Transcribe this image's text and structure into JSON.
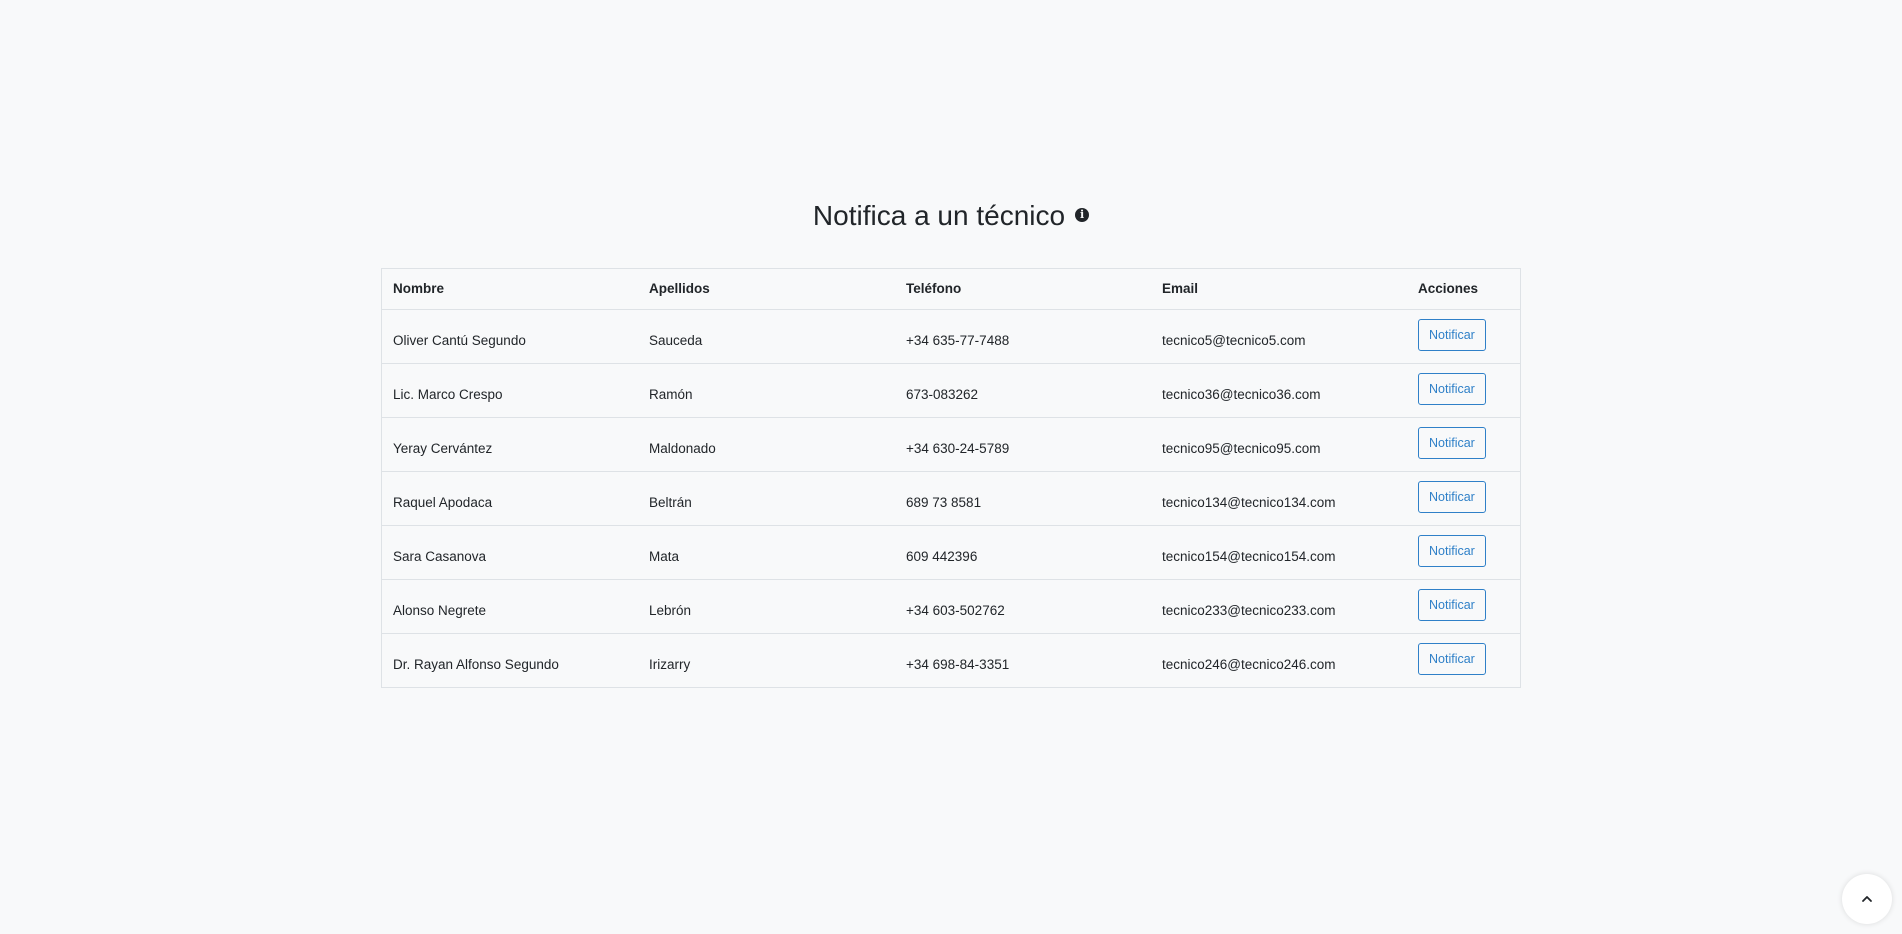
{
  "header": {
    "title": "Notifica a un técnico",
    "info_icon": "info-circle-icon"
  },
  "table": {
    "columns": [
      "Nombre",
      "Apellidos",
      "Teléfono",
      "Email",
      "Acciones"
    ],
    "rows": [
      {
        "nombre": "Oliver Cantú Segundo",
        "apellidos": "Sauceda",
        "telefono": "+34 635-77-7488",
        "email": "tecnico5@tecnico5.com",
        "action": "Notificar"
      },
      {
        "nombre": "Lic. Marco Crespo",
        "apellidos": "Ramón",
        "telefono": "673-083262",
        "email": "tecnico36@tecnico36.com",
        "action": "Notificar"
      },
      {
        "nombre": "Yeray Cervántez",
        "apellidos": "Maldonado",
        "telefono": "+34 630-24-5789",
        "email": "tecnico95@tecnico95.com",
        "action": "Notificar"
      },
      {
        "nombre": "Raquel Apodaca",
        "apellidos": "Beltrán",
        "telefono": "689 73 8581",
        "email": "tecnico134@tecnico134.com",
        "action": "Notificar"
      },
      {
        "nombre": "Sara Casanova",
        "apellidos": "Mata",
        "telefono": "609 442396",
        "email": "tecnico154@tecnico154.com",
        "action": "Notificar"
      },
      {
        "nombre": "Alonso Negrete",
        "apellidos": "Lebrón",
        "telefono": "+34 603-502762",
        "email": "tecnico233@tecnico233.com",
        "action": "Notificar"
      },
      {
        "nombre": "Dr. Rayan Alfonso Segundo",
        "apellidos": "Irizarry",
        "telefono": "+34 698-84-3351",
        "email": "tecnico246@tecnico246.com",
        "action": "Notificar"
      }
    ]
  },
  "scroll_top": {
    "icon": "chevron-up-icon"
  },
  "colors": {
    "background": "#f8f9fa",
    "accent": "#2f80c8",
    "border": "#dee2e6"
  }
}
